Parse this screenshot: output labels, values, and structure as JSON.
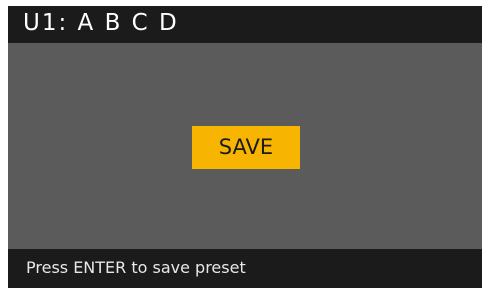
{
  "header": {
    "title": "U1: A B C D"
  },
  "main": {
    "save_label": "SAVE"
  },
  "footer": {
    "hint": "Press ENTER to save preset"
  },
  "colors": {
    "background": "#5b5b5b",
    "bar": "#1c1b1b",
    "accent": "#f7b400",
    "text": "#ffffff"
  }
}
